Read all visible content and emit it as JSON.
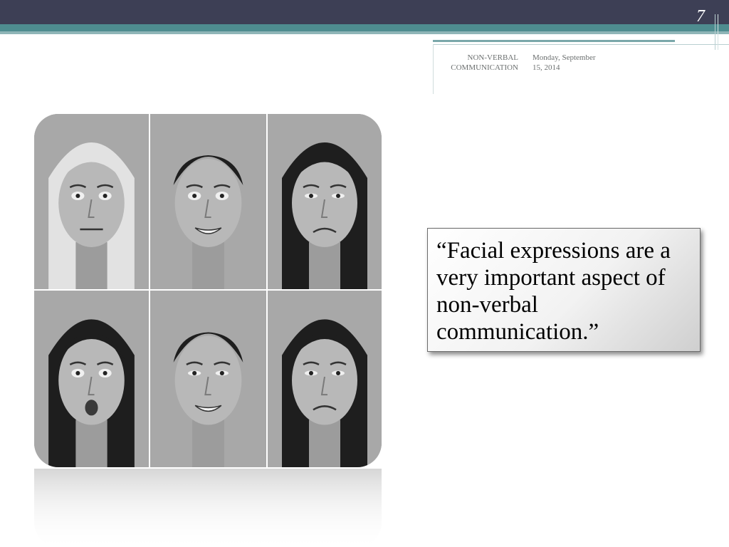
{
  "slide": {
    "number": "7",
    "header": {
      "topic": "NON-VERBAL COMMUNICATION",
      "date": "Monday, September 15, 2014"
    },
    "quote": "“Facial expressions are a very important aspect of non-verbal communication.”"
  },
  "photos": {
    "count": 6,
    "icon": "face-photo",
    "colors": {
      "skin": "#b8b8b8",
      "hair_dark": "#1e1e1e",
      "hair_light": "#e2e2e2",
      "background": "#a8a8a8"
    }
  },
  "theme": {
    "top_bar": "#3d3f55",
    "accent_teal": "#4e8c8f",
    "meta_text": "#6b6f6f"
  }
}
